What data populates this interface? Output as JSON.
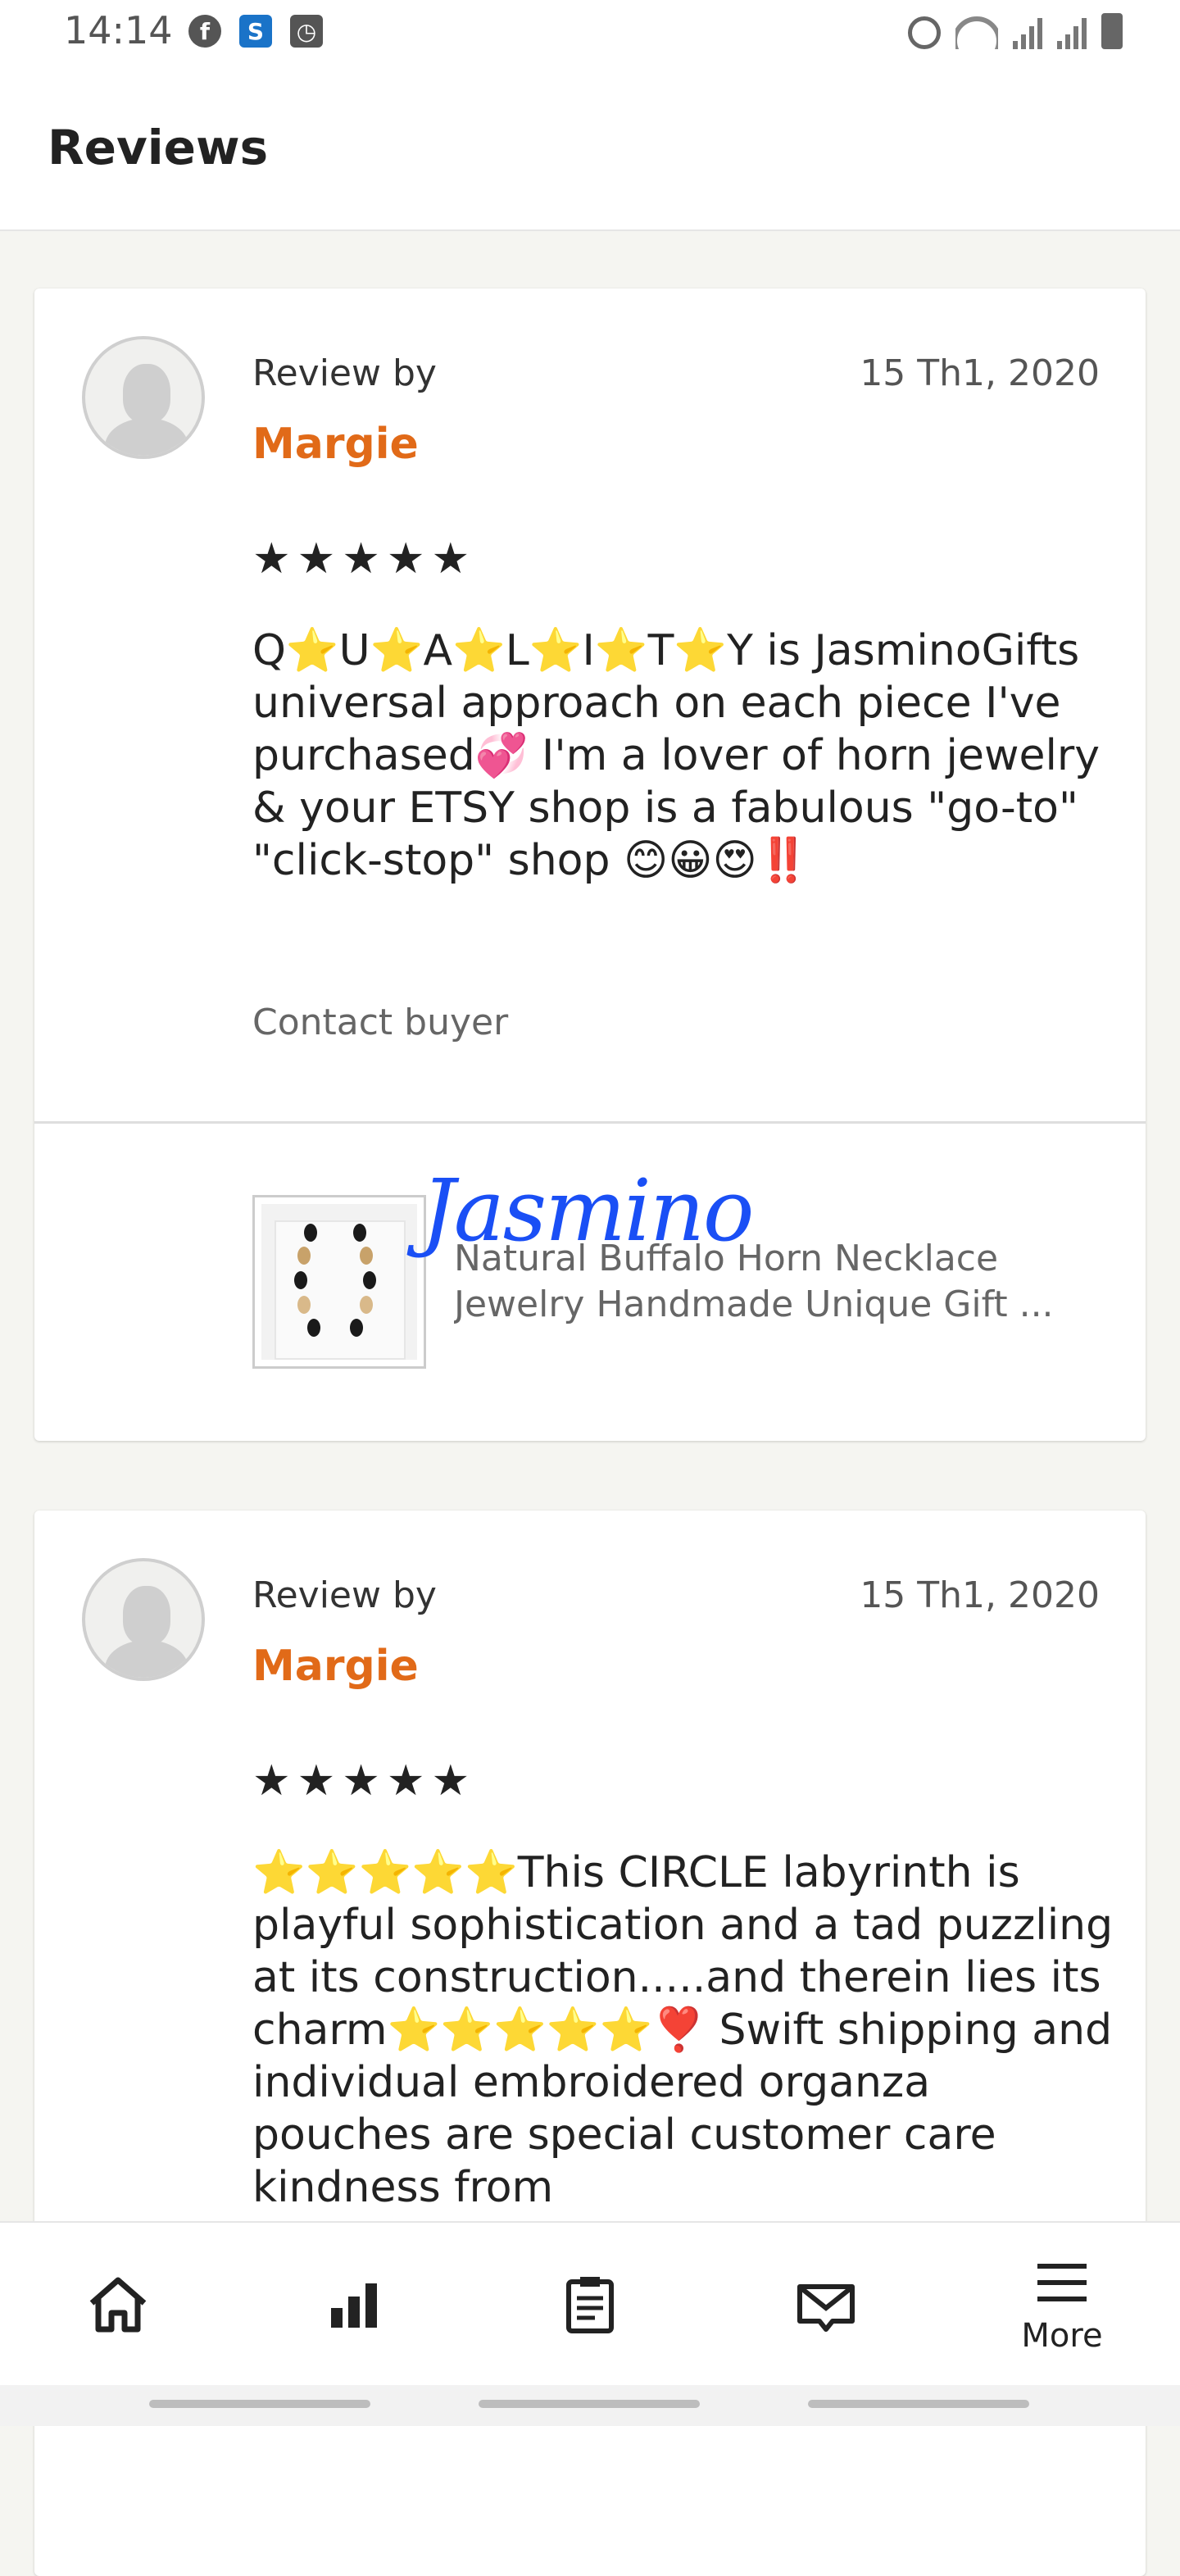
{
  "status_bar": {
    "time": "14:14",
    "left_icons": [
      "facebook-icon",
      "s-app-icon",
      "clock-app-icon"
    ],
    "right_icons": [
      "alarm-icon",
      "wifi-icon",
      "signal-icon",
      "signal-icon",
      "battery-icon"
    ]
  },
  "header": {
    "title": "Reviews"
  },
  "reviews": [
    {
      "review_by_label": "Review by",
      "reviewer": "Margie",
      "date": "15 Th1, 2020",
      "stars": "★★★★★",
      "text": "Q⭐U⭐A⭐L⭐I⭐T⭐Y is JasminoGifts universal approach on each piece I've purchased💞 I'm a lover of horn jewelry & your ETSY shop is a fabulous \"go-to\" \"click-stop\" shop 😊😀😍‼️",
      "contact_label": "Contact buyer",
      "listing": {
        "watermark": "Jasmino",
        "title_line1": "Natural Buffalo Horn Necklace",
        "title_line2": "Jewelry Handmade Unique Gift ..."
      }
    },
    {
      "review_by_label": "Review by",
      "reviewer": "Margie",
      "date": "15 Th1, 2020",
      "stars": "★★★★★",
      "text": "⭐⭐⭐⭐⭐This CIRCLE labyrinth is playful sophistication and a tad puzzling at its construction.....and therein lies its charm⭐⭐⭐⭐⭐❣️ Swift shipping and individual embroidered organza pouches are special customer care kindness from"
    }
  ],
  "bottom_nav": {
    "items": [
      {
        "icon": "home-icon",
        "label": ""
      },
      {
        "icon": "stats-icon",
        "label": ""
      },
      {
        "icon": "orders-icon",
        "label": ""
      },
      {
        "icon": "messages-icon",
        "label": ""
      },
      {
        "icon": "menu-icon",
        "label": "More"
      }
    ]
  },
  "colors": {
    "accent": "#e16a18",
    "watermark": "#1a4ff5"
  }
}
